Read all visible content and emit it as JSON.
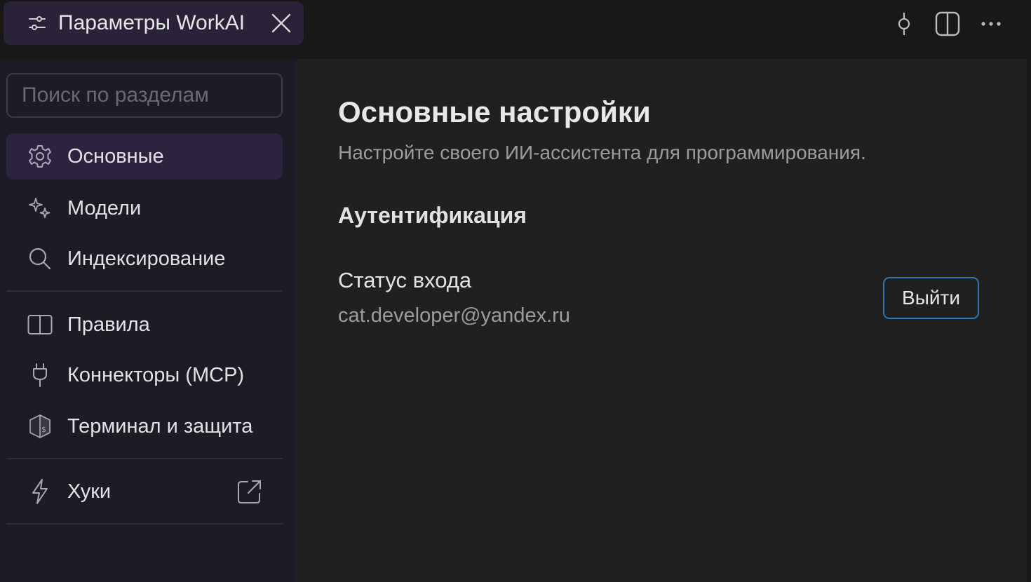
{
  "tab": {
    "title": "Параметры WorkAI",
    "icon": "sliders-icon",
    "close_icon": "close-icon"
  },
  "top_actions": [
    {
      "name": "commit-icon"
    },
    {
      "name": "split-view-icon"
    },
    {
      "name": "more-icon"
    }
  ],
  "sidebar": {
    "search_placeholder": "Поиск по разделам",
    "groups": [
      [
        {
          "label": "Основные",
          "icon": "gear-icon",
          "active": true
        },
        {
          "label": "Модели",
          "icon": "sparkles-icon",
          "active": false
        },
        {
          "label": "Индексирование",
          "icon": "search-icon",
          "active": false
        }
      ],
      [
        {
          "label": "Правила",
          "icon": "book-icon",
          "active": false
        },
        {
          "label": "Коннекторы (MCP)",
          "icon": "plug-icon",
          "active": false
        },
        {
          "label": "Терминал и защита",
          "icon": "terminal-shield-icon",
          "active": false
        }
      ],
      [
        {
          "label": "Хуки",
          "icon": "lightning-icon",
          "active": false,
          "external": "external-link-icon"
        }
      ]
    ]
  },
  "main": {
    "title": "Основные настройки",
    "subtitle": "Настройте своего ИИ-ассистента для программирования.",
    "section_title": "Аутентификация",
    "login_status_label": "Статус входа",
    "login_email": "cat.developer@yandex.ru",
    "logout_label": "Выйти"
  },
  "colors": {
    "accent_active_bg": "#2c2340",
    "button_border": "#2f78b5",
    "sidebar_bg": "#1c1b26",
    "main_bg": "#202020"
  }
}
